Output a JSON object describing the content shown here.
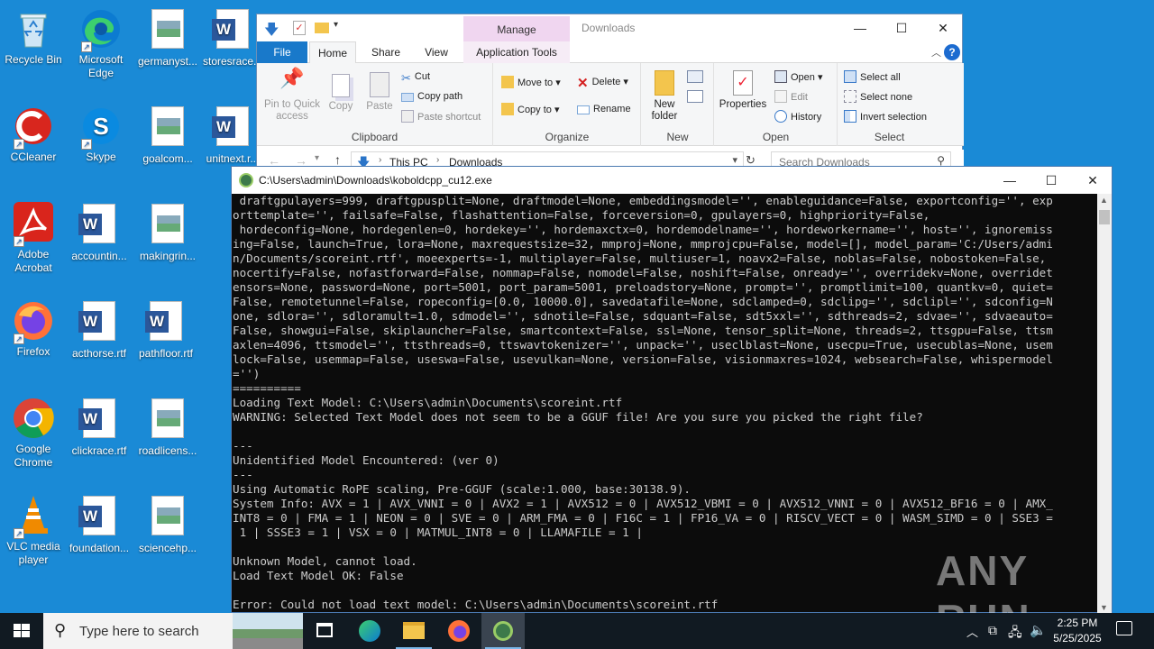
{
  "desktop": {
    "icons": [
      {
        "label": "Recycle Bin"
      },
      {
        "label": "Microsoft Edge"
      },
      {
        "label": "germanyst..."
      },
      {
        "label": "storesrace..."
      },
      {
        "label": "CCleaner"
      },
      {
        "label": "Skype"
      },
      {
        "label": "goalcom..."
      },
      {
        "label": "unitnext.r..."
      },
      {
        "label": "Adobe Acrobat"
      },
      {
        "label": "accountin..."
      },
      {
        "label": "makingrin..."
      },
      {
        "label": "Firefox"
      },
      {
        "label": "acthorse.rtf"
      },
      {
        "label": "pathfloor.rtf"
      },
      {
        "label": "Google Chrome"
      },
      {
        "label": "clickrace.rtf"
      },
      {
        "label": "roadlicens..."
      },
      {
        "label": "VLC media player"
      },
      {
        "label": "foundation..."
      },
      {
        "label": "sciencehp..."
      }
    ]
  },
  "explorer": {
    "title": "Downloads",
    "manage_tab": "Manage",
    "tabs": [
      "File",
      "Home",
      "Share",
      "View",
      "Application Tools"
    ],
    "clipboard": {
      "pin": "Pin to Quick access",
      "copy": "Copy",
      "paste": "Paste",
      "cut": "Cut",
      "copy_path": "Copy path",
      "paste_shortcut": "Paste shortcut",
      "label": "Clipboard"
    },
    "organize": {
      "move_to": "Move to",
      "copy_to": "Copy to",
      "delete": "Delete",
      "rename": "Rename",
      "label": "Organize"
    },
    "new": {
      "new_folder": "New folder",
      "label": "New"
    },
    "open": {
      "properties": "Properties",
      "open": "Open",
      "edit": "Edit",
      "history": "History",
      "label": "Open"
    },
    "select": {
      "select_all": "Select all",
      "select_none": "Select none",
      "invert": "Invert selection",
      "label": "Select"
    },
    "address": {
      "this_pc": "This PC",
      "downloads": "Downloads"
    },
    "search_placeholder": "Search Downloads"
  },
  "console": {
    "title": "C:\\Users\\admin\\Downloads\\koboldcpp_cu12.exe",
    "lines": [
      " draftgpulayers=999, draftgpusplit=None, draftmodel=None, embeddingsmodel='', enableguidance=False, exportconfig='', exp",
      "orttemplate='', failsafe=False, flashattention=False, forceversion=0, gpulayers=0, highpriority=False,",
      " hordeconfig=None, hordegenlen=0, hordekey='', hordemaxctx=0, hordemodelname='', hordeworkername='', host='', ignoremiss",
      "ing=False, launch=True, lora=None, maxrequestsize=32, mmproj=None, mmprojcpu=False, model=[], model_param='C:/Users/admi",
      "n/Documents/scoreint.rtf', moeexperts=-1, multiplayer=False, multiuser=1, noavx2=False, noblas=False, nobostoken=False,",
      "nocertify=False, nofastforward=False, nommap=False, nomodel=False, noshift=False, onready='', overridekv=None, overridet",
      "ensors=None, password=None, port=5001, port_param=5001, preloadstory=None, prompt='', promptlimit=100, quantkv=0, quiet=",
      "False, remotetunnel=False, ropeconfig=[0.0, 10000.0], savedatafile=None, sdclamped=0, sdclipg='', sdclipl='', sdconfig=N",
      "one, sdlora='', sdloramult=1.0, sdmodel='', sdnotile=False, sdquant=False, sdt5xxl='', sdthreads=2, sdvae='', sdvaeauto=",
      "False, showgui=False, skiplauncher=False, smartcontext=False, ssl=None, tensor_split=None, threads=2, ttsgpu=False, ttsm",
      "axlen=4096, ttsmodel='', ttsthreads=0, ttswavtokenizer='', unpack='', useclblast=None, usecpu=True, usecublas=None, usem",
      "lock=False, usemmap=False, useswa=False, usevulkan=None, version=False, visionmaxres=1024, websearch=False, whispermodel",
      "='')",
      "==========",
      "Loading Text Model: C:\\Users\\admin\\Documents\\scoreint.rtf",
      "WARNING: Selected Text Model does not seem to be a GGUF file! Are you sure you picked the right file?",
      "",
      "---",
      "Unidentified Model Encountered: (ver 0)",
      "---",
      "Using Automatic RoPE scaling, Pre-GGUF (scale:1.000, base:30138.9).",
      "System Info: AVX = 1 | AVX_VNNI = 0 | AVX2 = 1 | AVX512 = 0 | AVX512_VBMI = 0 | AVX512_VNNI = 0 | AVX512_BF16 = 0 | AMX_",
      "INT8 = 0 | FMA = 1 | NEON = 0 | SVE = 0 | ARM_FMA = 0 | F16C = 1 | FP16_VA = 0 | RISCV_VECT = 0 | WASM_SIMD = 0 | SSE3 =",
      " 1 | SSSE3 = 1 | VSX = 0 | MATMUL_INT8 = 0 | LLAMAFILE = 1 |",
      "",
      "Unknown Model, cannot load.",
      "Load Text Model OK: False",
      "",
      "Error: Could not load text model: C:\\Users\\admin\\Documents\\scoreint.rtf"
    ]
  },
  "taskbar": {
    "search_placeholder": "Type here to search",
    "time": "2:25 PM",
    "date": "5/25/2025"
  },
  "watermark": "ANY RUN"
}
